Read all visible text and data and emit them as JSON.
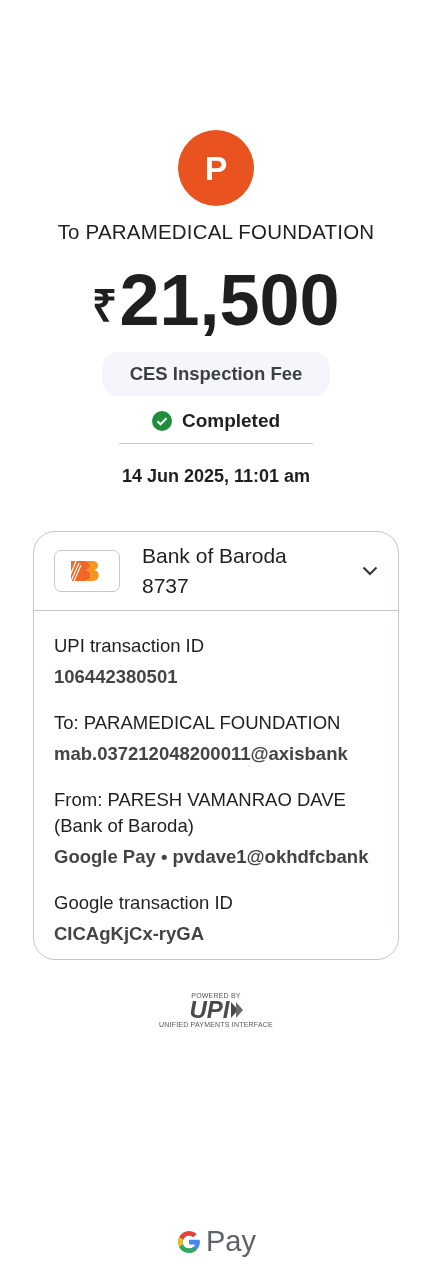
{
  "payee": {
    "initial": "P",
    "color": "#e8531f",
    "title": "To PARAMEDICAL FOUNDATION"
  },
  "amount": {
    "currency": "₹",
    "value": "21,500"
  },
  "note": "CES Inspection Fee",
  "status": {
    "kind": "completed",
    "label": "Completed"
  },
  "date": "14 Jun 2025, 11:01 am",
  "account": {
    "bank": "Bank of Baroda",
    "number": "8737"
  },
  "details": [
    {
      "label": "UPI transaction ID",
      "value": "106442380501"
    },
    {
      "label": "To: PARAMEDICAL FOUNDATION",
      "value": "mab.037212048200011@axisbank"
    },
    {
      "label": "From: PARESH VAMANRAO DAVE (Bank of Baroda)",
      "value": "Google Pay • pvdave1@okhdfcbank"
    },
    {
      "label": "Google transaction ID",
      "value": "CICAgKjCx-ryGA"
    }
  ],
  "upi_badge": {
    "top": "POWERED BY",
    "logo": "UPI",
    "bottom": "UNIFIED PAYMENTS INTERFACE"
  },
  "brand": {
    "word": "Pay"
  }
}
